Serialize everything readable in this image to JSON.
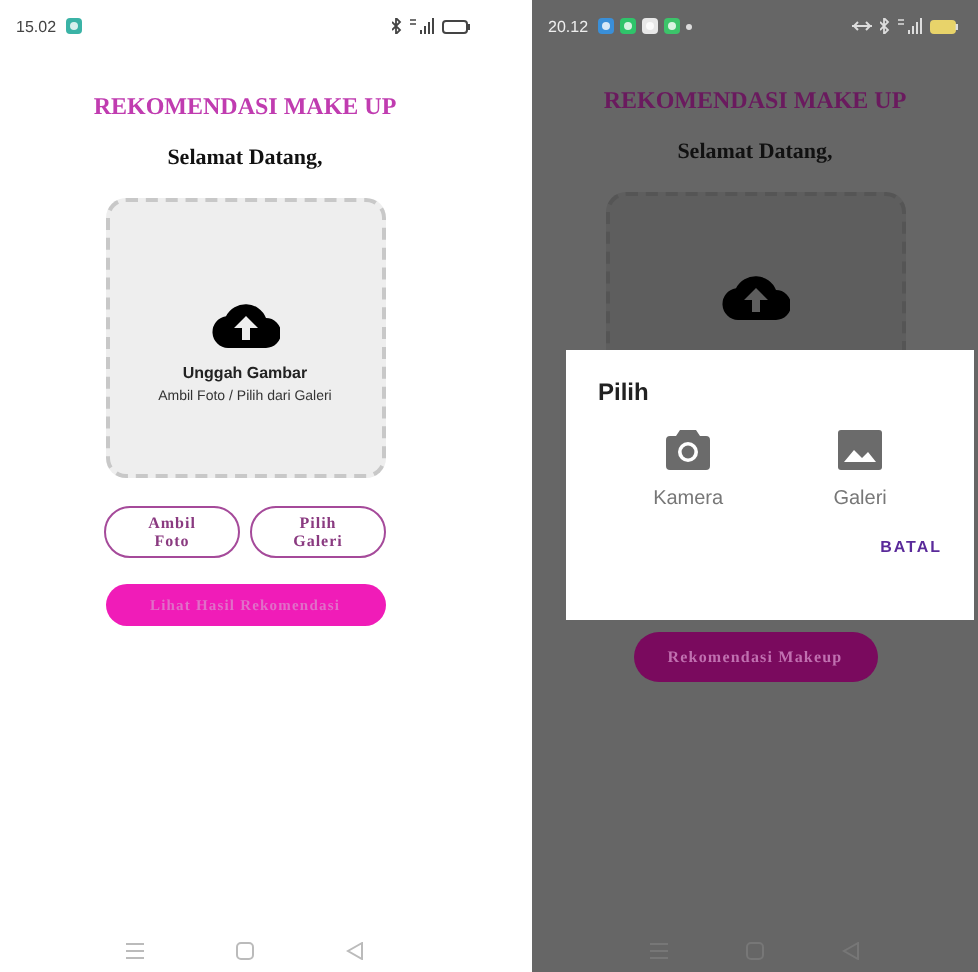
{
  "screens": [
    {
      "dimmed": false,
      "status_bar": {
        "time": "15.02",
        "notification_icons": [
          {
            "kind": "app",
            "color": "#3ab3a6"
          }
        ],
        "system_icons": [
          {
            "kind": "bluetooth"
          },
          {
            "kind": "signal"
          },
          {
            "kind": "battery"
          }
        ]
      },
      "title": "REKOMENDASI MAKE UP",
      "greeting": "Selamat Datang,",
      "upload": {
        "title": "Unggah Gambar",
        "hint": "Ambil Foto / Pilih dari Galeri"
      },
      "buttons": [
        {
          "kind": "outline",
          "label": "Ambil Foto"
        },
        {
          "kind": "outline",
          "label": "Pilih Galeri"
        },
        {
          "kind": "filled",
          "label": "Lihat Hasil Rekomendasi"
        }
      ]
    },
    {
      "dimmed": true,
      "status_bar": {
        "time": "20.12",
        "notification_icons": [
          {
            "kind": "app",
            "color": "#3a8fd8"
          },
          {
            "kind": "app",
            "color": "#2fc46a"
          },
          {
            "kind": "app",
            "color": "#e8e8e8"
          },
          {
            "kind": "app",
            "color": "#3cc46a"
          },
          {
            "kind": "dot"
          }
        ],
        "system_icons": [
          {
            "kind": "hotspot"
          },
          {
            "kind": "bluetooth"
          },
          {
            "kind": "signal"
          },
          {
            "kind": "battery"
          }
        ]
      },
      "title": "REKOMENDASI MAKE UP",
      "greeting": "Selamat Datang,",
      "buttons": [
        {
          "kind": "filled",
          "label": "Rekomendasi Makeup"
        }
      ],
      "dialog": {
        "title": "Pilih",
        "options": [
          {
            "kind": "camera",
            "label": "Kamera"
          },
          {
            "kind": "gallery",
            "label": "Galeri"
          }
        ],
        "cancel": "BATAL"
      }
    }
  ]
}
